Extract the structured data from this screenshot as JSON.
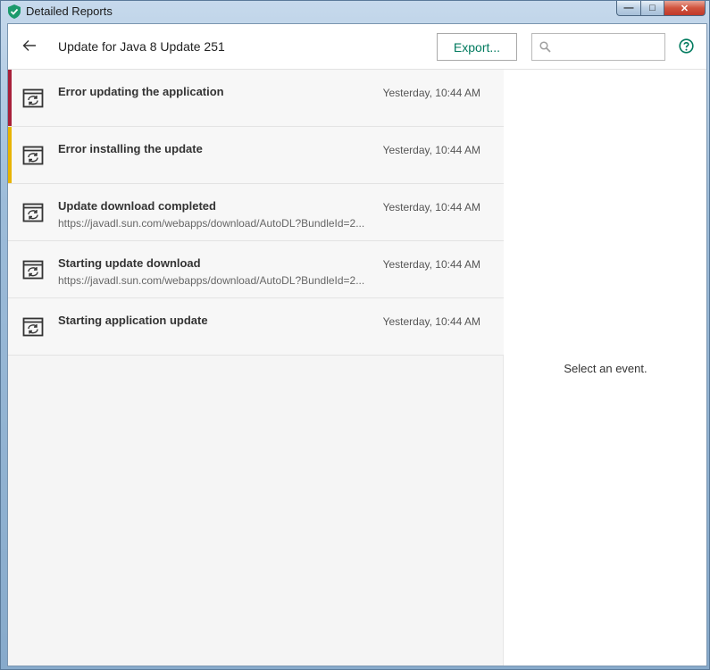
{
  "window": {
    "title": "Detailed Reports",
    "controls": {
      "minimize": "—",
      "maximize": "□",
      "close": "✕"
    }
  },
  "header": {
    "title": "Update for Java 8 Update 251",
    "export_label": "Export...",
    "search_value": "",
    "search_placeholder": ""
  },
  "events": [
    {
      "title": "Error updating the application",
      "time": "Yesterday, 10:44 AM",
      "subtitle": "",
      "severity_color": "#a8203a"
    },
    {
      "title": "Error installing the update",
      "time": "Yesterday, 10:44 AM",
      "subtitle": "",
      "severity_color": "#e8b400"
    },
    {
      "title": "Update download completed",
      "time": "Yesterday, 10:44 AM",
      "subtitle": "https://javadl.sun.com/webapps/download/AutoDL?BundleId=2...",
      "severity_color": ""
    },
    {
      "title": "Starting update download",
      "time": "Yesterday, 10:44 AM",
      "subtitle": "https://javadl.sun.com/webapps/download/AutoDL?BundleId=2...",
      "severity_color": ""
    },
    {
      "title": "Starting application update",
      "time": "Yesterday, 10:44 AM",
      "subtitle": "",
      "severity_color": ""
    }
  ],
  "detail": {
    "empty_message": "Select an event."
  },
  "colors": {
    "accent": "#007a5e",
    "error": "#a8203a",
    "warning": "#e8b400"
  },
  "icons": {
    "app": "shield-icon",
    "back": "arrow-left-icon",
    "search": "search-icon",
    "help": "help-icon",
    "event": "update-window-icon"
  }
}
